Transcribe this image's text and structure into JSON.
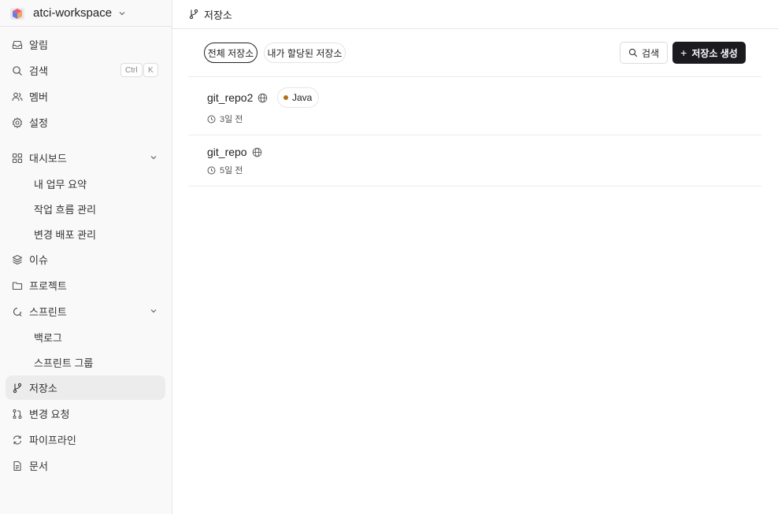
{
  "workspace": {
    "name": "atci-workspace"
  },
  "sidebar": {
    "notifications": "알림",
    "search": "검색",
    "search_kbd_ctrl": "Ctrl",
    "search_kbd_key": "K",
    "members": "멤버",
    "settings": "설정",
    "dashboard": "대시보드",
    "dashboard_sub": [
      "내 업무 요약",
      "작업 흐름 관리",
      "변경 배포 관리"
    ],
    "issues": "이슈",
    "projects": "프로젝트",
    "sprints": "스프린트",
    "sprints_sub": [
      "백로그",
      "스프린트 그룹"
    ],
    "repositories": "저장소",
    "change_requests": "변경 요청",
    "pipelines": "파이프라인",
    "docs": "문서"
  },
  "header": {
    "title": "저장소"
  },
  "tabs": {
    "all": "전체 저장소",
    "assigned": "내가 할당된 저장소"
  },
  "toolbar": {
    "search_label": "검색",
    "create_label": "저장소 생성"
  },
  "repos": [
    {
      "name": "git_repo2",
      "language": "Java",
      "language_color": "#b07219",
      "updated": "3일 전"
    },
    {
      "name": "git_repo",
      "updated": "5일 전"
    }
  ]
}
